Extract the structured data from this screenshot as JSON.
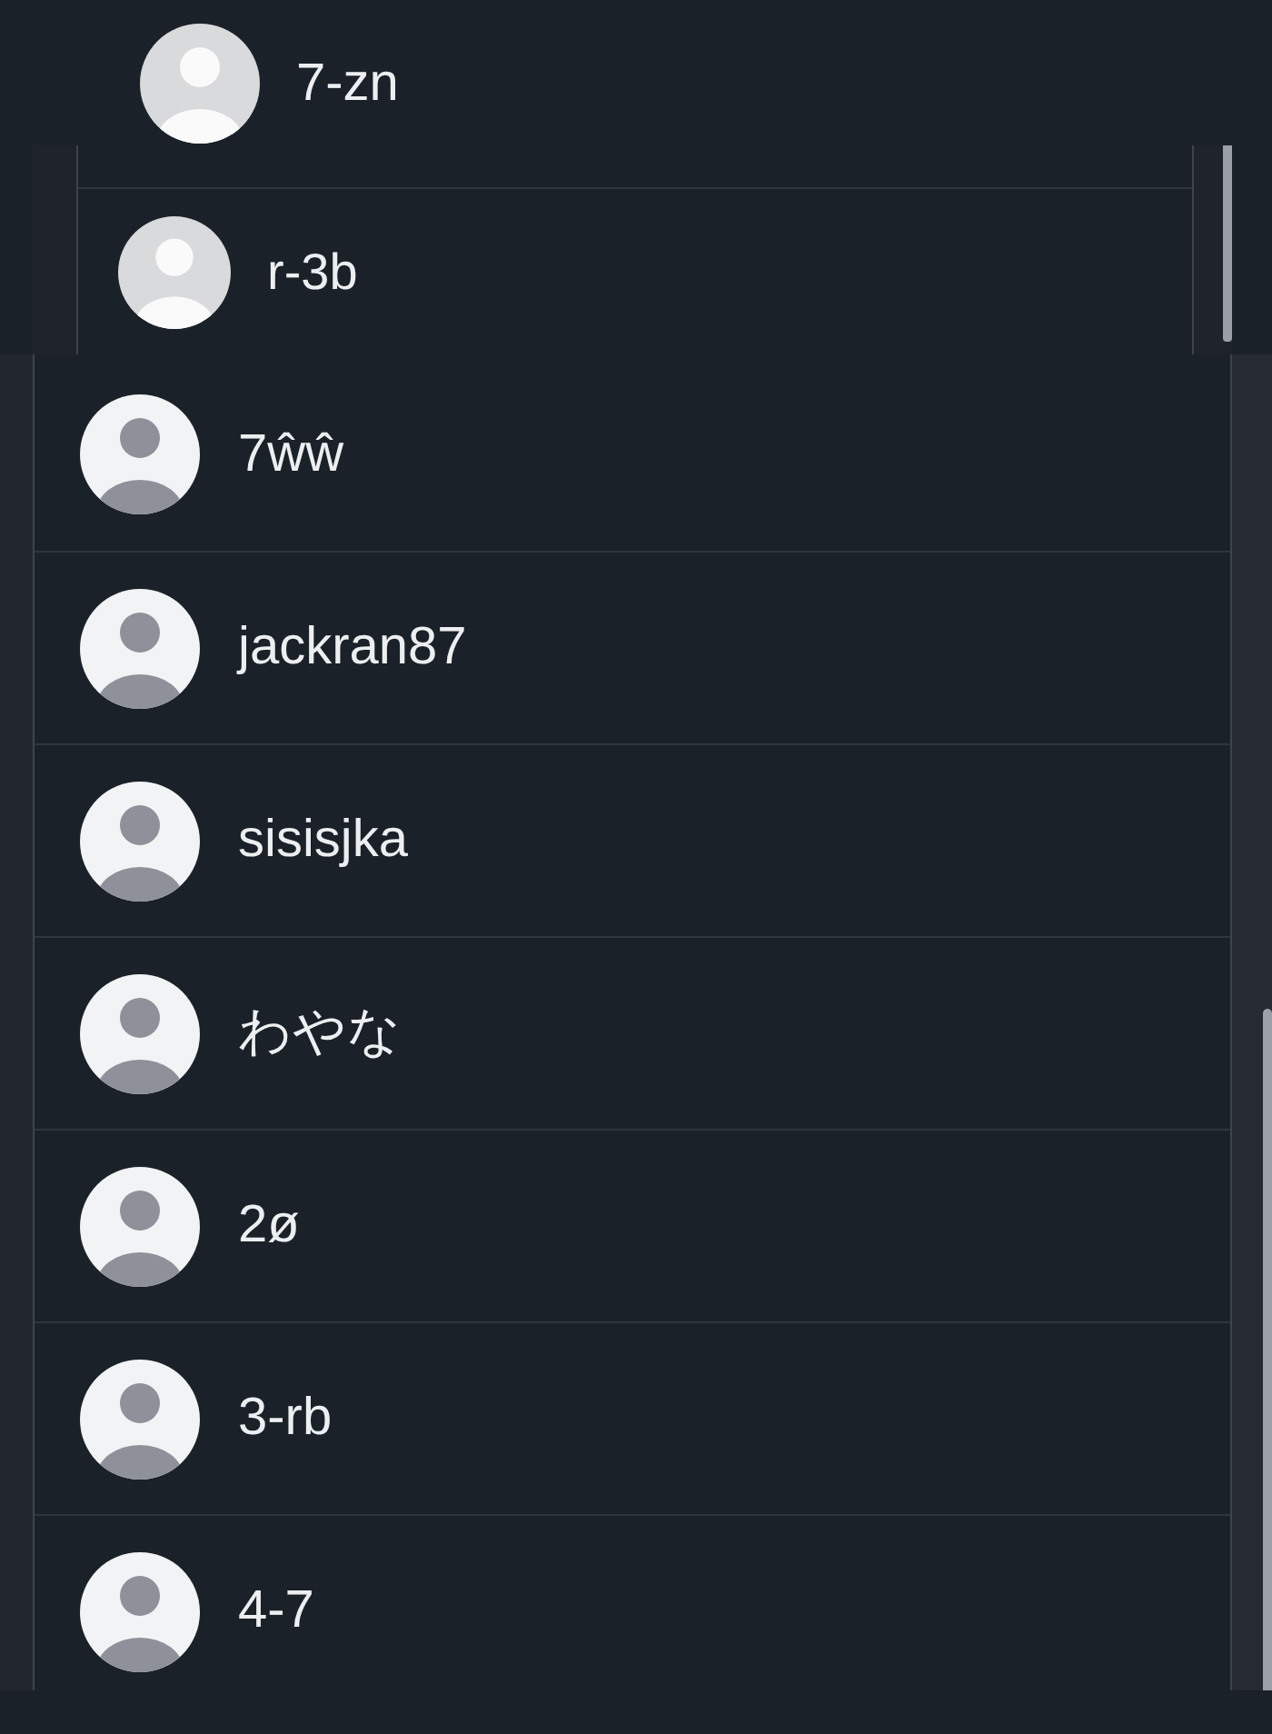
{
  "stacked_rows": [
    {
      "name": "7-zn"
    },
    {
      "name": "r-3b"
    }
  ],
  "users": [
    {
      "name": "7ŵŵ"
    },
    {
      "name": "jackran87"
    },
    {
      "name": "sisisjka"
    },
    {
      "name": "わやな"
    },
    {
      "name": "2ø"
    },
    {
      "name": "3-rb"
    },
    {
      "name": "4-7"
    }
  ]
}
